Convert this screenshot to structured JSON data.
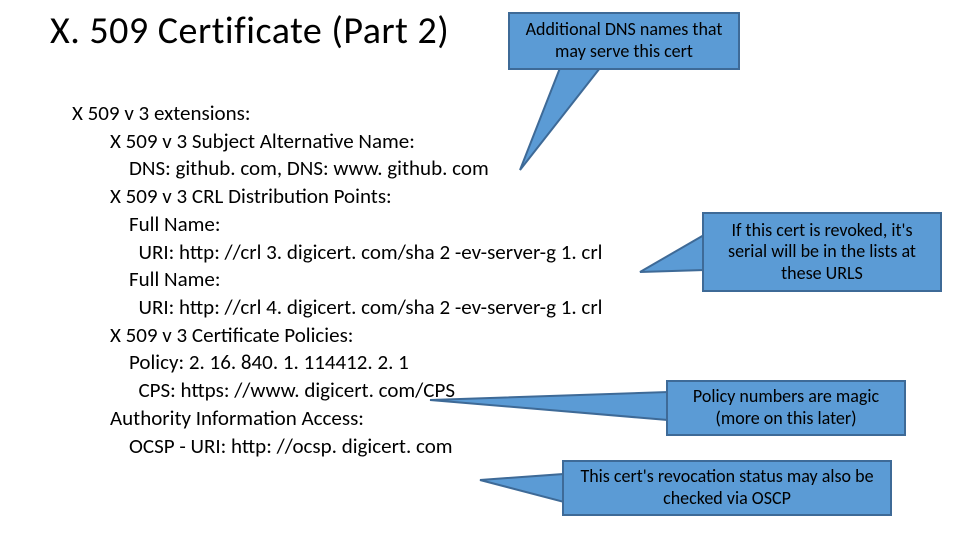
{
  "title": "X. 509 Certificate (Part 2)",
  "body": {
    "l0": "X 509 v 3 extensions:",
    "l1": "        X 509 v 3 Subject Alternative Name:",
    "l2": "            DNS: github. com, DNS: www. github. com",
    "l3": "        X 509 v 3 CRL Distribution Points:",
    "l4": "            Full Name:",
    "l5": "              URI: http: //crl 3. digicert. com/sha 2 -ev-server-g 1. crl",
    "l6": "            Full Name:",
    "l7": "              URI: http: //crl 4. digicert. com/sha 2 -ev-server-g 1. crl",
    "l8": "        X 509 v 3 Certificate Policies:",
    "l9": "            Policy: 2. 16. 840. 1. 114412. 2. 1",
    "l10": "              CPS: https: //www. digicert. com/CPS",
    "l11": "        Authority Information Access:",
    "l12": "            OCSP - URI: http: //ocsp. digicert. com"
  },
  "callouts": {
    "c1": "Additional DNS names that may serve this cert",
    "c2": "If this cert is revoked, it's serial will be in the lists at these URLS",
    "c3": "Policy numbers are magic (more on this later)",
    "c4": "This cert's revocation status may also be checked via OSCP"
  },
  "colors": {
    "callout_fill": "#5b9bd5",
    "callout_border": "#3e6a97"
  }
}
